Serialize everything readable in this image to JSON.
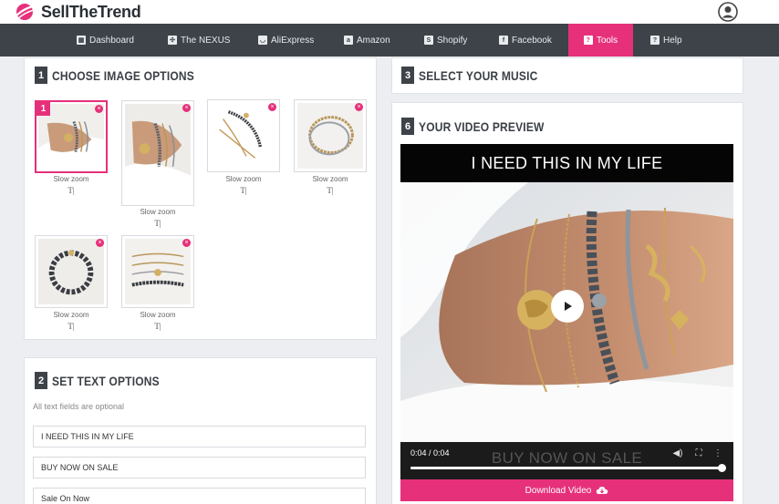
{
  "app": {
    "brand": "SellTheTrend"
  },
  "nav": {
    "items": [
      {
        "label": "Dashboard",
        "icon": "dashboard-icon"
      },
      {
        "label": "The NEXUS",
        "icon": "nexus-icon"
      },
      {
        "label": "AliExpress",
        "icon": "aliexpress-icon"
      },
      {
        "label": "Amazon",
        "icon": "amazon-icon"
      },
      {
        "label": "Shopify",
        "icon": "shopify-icon"
      },
      {
        "label": "Facebook",
        "icon": "facebook-icon"
      },
      {
        "label": "Tools",
        "icon": "tools-icon",
        "active": true
      },
      {
        "label": "Help",
        "icon": "help-icon"
      }
    ]
  },
  "image_options": {
    "step": "1",
    "title": "CHOOSE IMAGE OPTIONS",
    "thumbnails": [
      {
        "badge": "1",
        "effect": "Slow zoom",
        "text_icon": "T|",
        "selected": true
      },
      {
        "effect": "Slow zoom",
        "text_icon": "T|"
      },
      {
        "effect": "Slow zoom",
        "text_icon": "T|"
      },
      {
        "effect": "Slow zoom",
        "text_icon": "T|"
      },
      {
        "effect": "Slow zoom",
        "text_icon": "T|"
      },
      {
        "effect": "Slow zoom",
        "text_icon": "T|"
      }
    ]
  },
  "text_options": {
    "step": "2",
    "title": "SET TEXT OPTIONS",
    "hint": "All text fields are optional",
    "fields": [
      "I NEED THIS IN MY LIFE",
      "BUY NOW ON SALE",
      "Sale On Now"
    ]
  },
  "music": {
    "step": "3",
    "title": "SELECT YOUR MUSIC"
  },
  "preview": {
    "step": "6",
    "title": "YOUR VIDEO PREVIEW",
    "top_text": "I NEED THIS IN MY LIFE",
    "bottom_text": "BUY NOW ON SALE",
    "time": "0:04 / 0:04",
    "progress": 1.0,
    "download_label": "Download Video"
  },
  "colors": {
    "accent": "#e6307a",
    "nav_bg": "#3d4349",
    "page_bg": "#eceef1"
  }
}
